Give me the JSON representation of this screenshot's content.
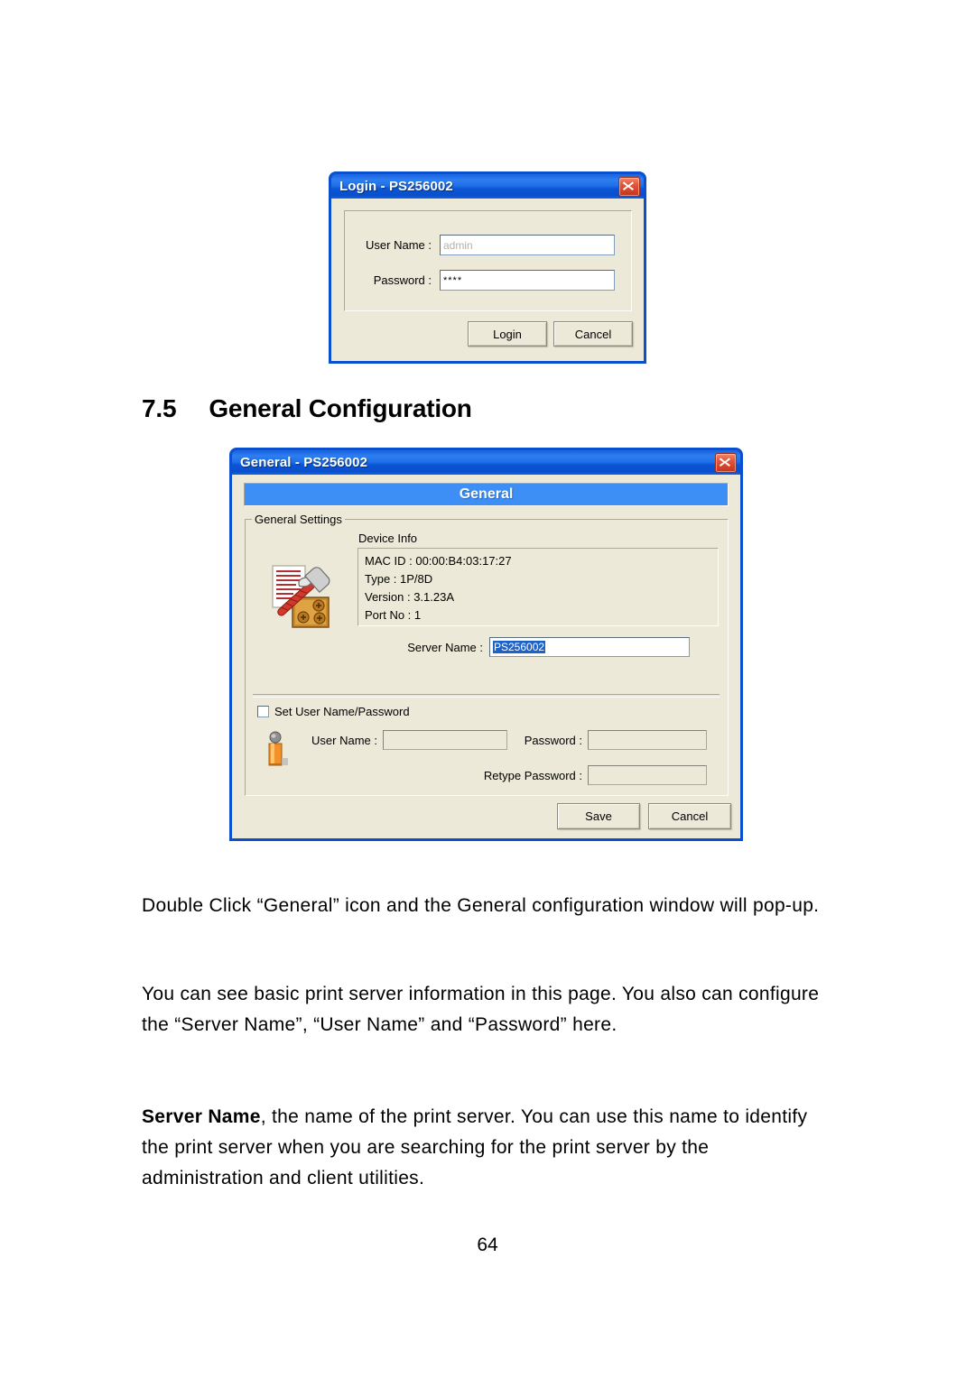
{
  "document": {
    "page_number": "64",
    "heading": {
      "number": "7.5",
      "title": "General Configuration"
    },
    "paragraphs": [
      "Double Click “General” icon and the General configuration window will pop-up.",
      "You can see basic print server information in this page. You also can configure the “Server Name”, “User Name” and “Password” here."
    ],
    "paragraph3": {
      "lead": "Server Name",
      "rest": ", the name of the print server. You can use this name to identify the print server when you are searching for the print server by the administration and client utilities."
    }
  },
  "login_dialog": {
    "title": "Login - PS256002",
    "close_icon": "close-icon",
    "fields": [
      {
        "label": "User Name :",
        "value": "admin",
        "ghost": true
      },
      {
        "label": "Password :",
        "value": "****",
        "ghost": false
      }
    ],
    "buttons": [
      {
        "label": "Login"
      },
      {
        "label": "Cancel"
      }
    ]
  },
  "general_dialog": {
    "title": "General - PS256002",
    "banner": "General",
    "close_icon": "close-icon",
    "group_legend": "General Settings",
    "device_info_label": "Device Info",
    "device_icon": "document-hammer-icon",
    "device_info": [
      "MAC ID : 00:00:B4:03:17:27",
      "Type : 1P/8D",
      "Version : 3.1.23A",
      "Port No : 1"
    ],
    "server_name": {
      "label": "Server Name :",
      "value": "PS256002",
      "selected": true
    },
    "set_credentials": {
      "checkbox_label": "Set User Name/Password",
      "checked": false,
      "user_icon": "person-icon",
      "user_name": {
        "label": "User Name :",
        "value": ""
      },
      "password": {
        "label": "Password :",
        "value": ""
      },
      "retype_password": {
        "label": "Retype Password :",
        "value": ""
      }
    },
    "buttons": [
      {
        "label": "Save"
      },
      {
        "label": "Cancel"
      }
    ]
  },
  "colors": {
    "titlebar_blue": "#0a4fcd",
    "banner_blue": "#3d8ef5",
    "dialog_face": "#ece9d8",
    "selection_blue": "#1d62c9",
    "close_red": "#c8301a"
  }
}
